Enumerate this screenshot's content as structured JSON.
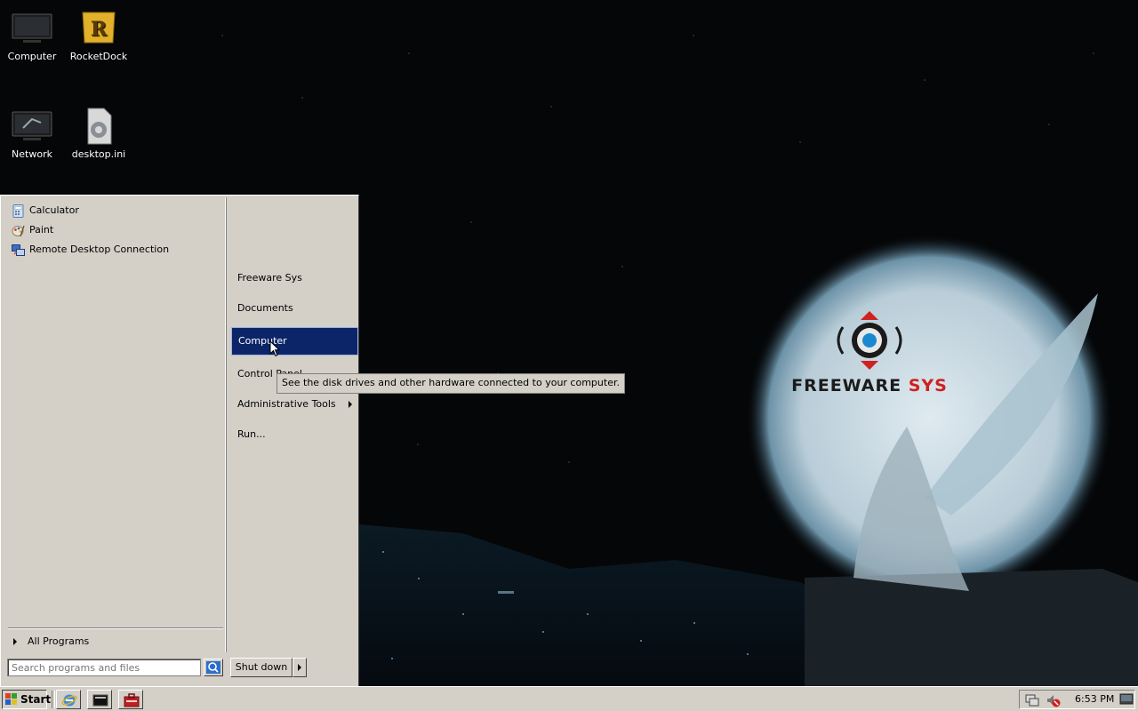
{
  "desktop": {
    "icons": [
      {
        "label": "Computer",
        "icon": "monitor-icon"
      },
      {
        "label": "RocketDock",
        "icon": "rocketdock-icon"
      },
      {
        "label": "Network",
        "icon": "network-icon"
      },
      {
        "label": "desktop.ini",
        "icon": "settings-file-icon"
      }
    ],
    "wallpaper": {
      "brand_main": "FREEWARE",
      "brand_accent": "SYS"
    }
  },
  "start_menu": {
    "programs": [
      {
        "label": "Calculator",
        "icon": "calculator-icon"
      },
      {
        "label": "Paint",
        "icon": "paint-icon"
      },
      {
        "label": "Remote Desktop Connection",
        "icon": "remote-desktop-icon"
      }
    ],
    "all_programs_label": "All Programs",
    "search_placeholder": "Search programs and files",
    "right_items": [
      {
        "label": "Freeware Sys"
      },
      {
        "label": "Documents"
      },
      {
        "label": "Computer",
        "selected": true
      },
      {
        "label": "Control Panel"
      },
      {
        "label": "Administrative Tools",
        "submenu": true
      },
      {
        "label": "Run..."
      }
    ],
    "shutdown_label": "Shut down",
    "tooltip": "See the disk drives and other hardware connected to your computer."
  },
  "taskbar": {
    "start_label": "Start",
    "quick_launch": [
      "internet-explorer-icon",
      "command-prompt-icon",
      "toolbox-icon"
    ],
    "tray_icons": [
      "network-tray-icon",
      "no-sound-icon"
    ],
    "clock": "6:53 PM"
  },
  "colors": {
    "selection": "#0c2569",
    "classic_face": "#d4d0c8",
    "desktop_bg": "#050607"
  }
}
